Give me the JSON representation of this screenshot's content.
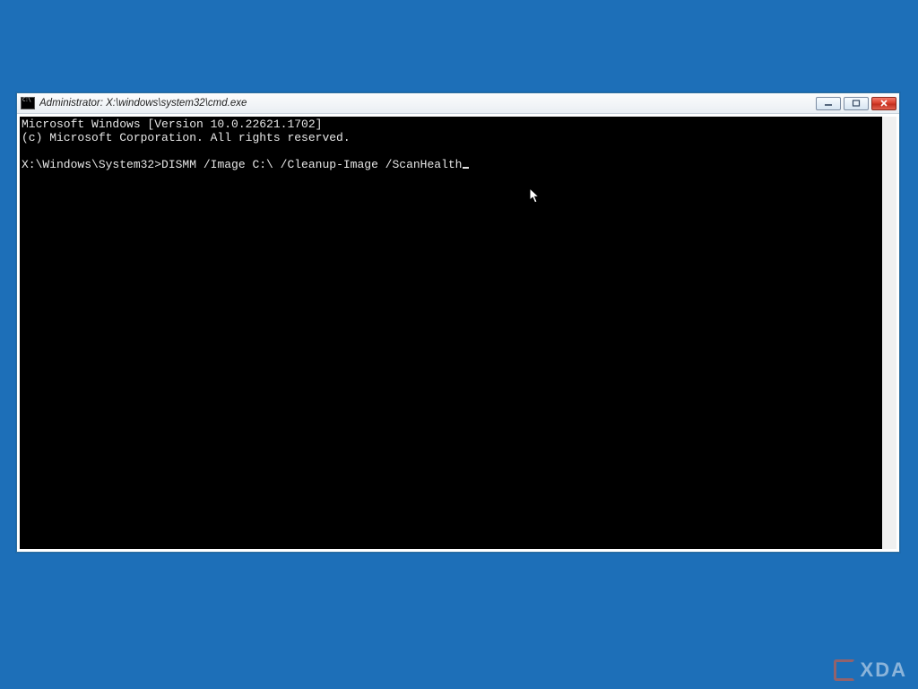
{
  "window": {
    "title": "Administrator: X:\\windows\\system32\\cmd.exe"
  },
  "console": {
    "line1": "Microsoft Windows [Version 10.0.22621.1702]",
    "line2": "(c) Microsoft Corporation. All rights reserved.",
    "blank": "",
    "prompt": "X:\\Windows\\System32>",
    "command": "DISMM /Image C:\\ /Cleanup-Image /ScanHealth"
  },
  "watermark": {
    "text": "XDA"
  }
}
